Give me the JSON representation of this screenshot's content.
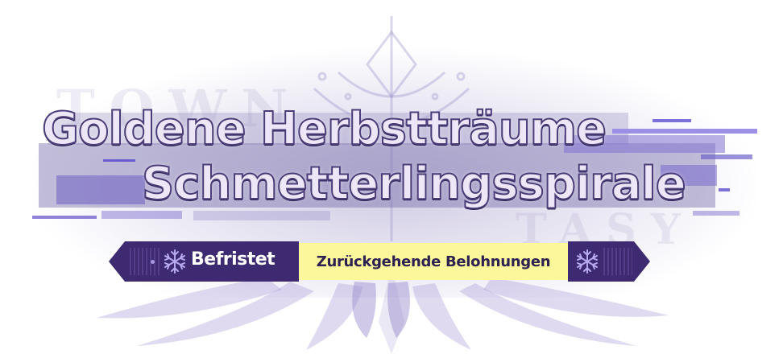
{
  "event": {
    "title_line_1": "Goldene Herbstträume",
    "title_line_2": "Schmetterlingsspirale",
    "watermark_left": "TOWN",
    "watermark_right": "TASY",
    "tag_label": "Befristet",
    "reward_label": "Zurückgehende Belohnungen"
  },
  "icons": {
    "banner_left": "snowflake-icon",
    "banner_right": "snowflake-icon",
    "background": "snowflake-ornament"
  },
  "colors": {
    "title_fill": "#ece6f7",
    "title_outline": "#4a3d78",
    "banner_dark": "#3d2a70",
    "banner_highlight": "#fbf79a",
    "accent": "#8f80d8"
  }
}
